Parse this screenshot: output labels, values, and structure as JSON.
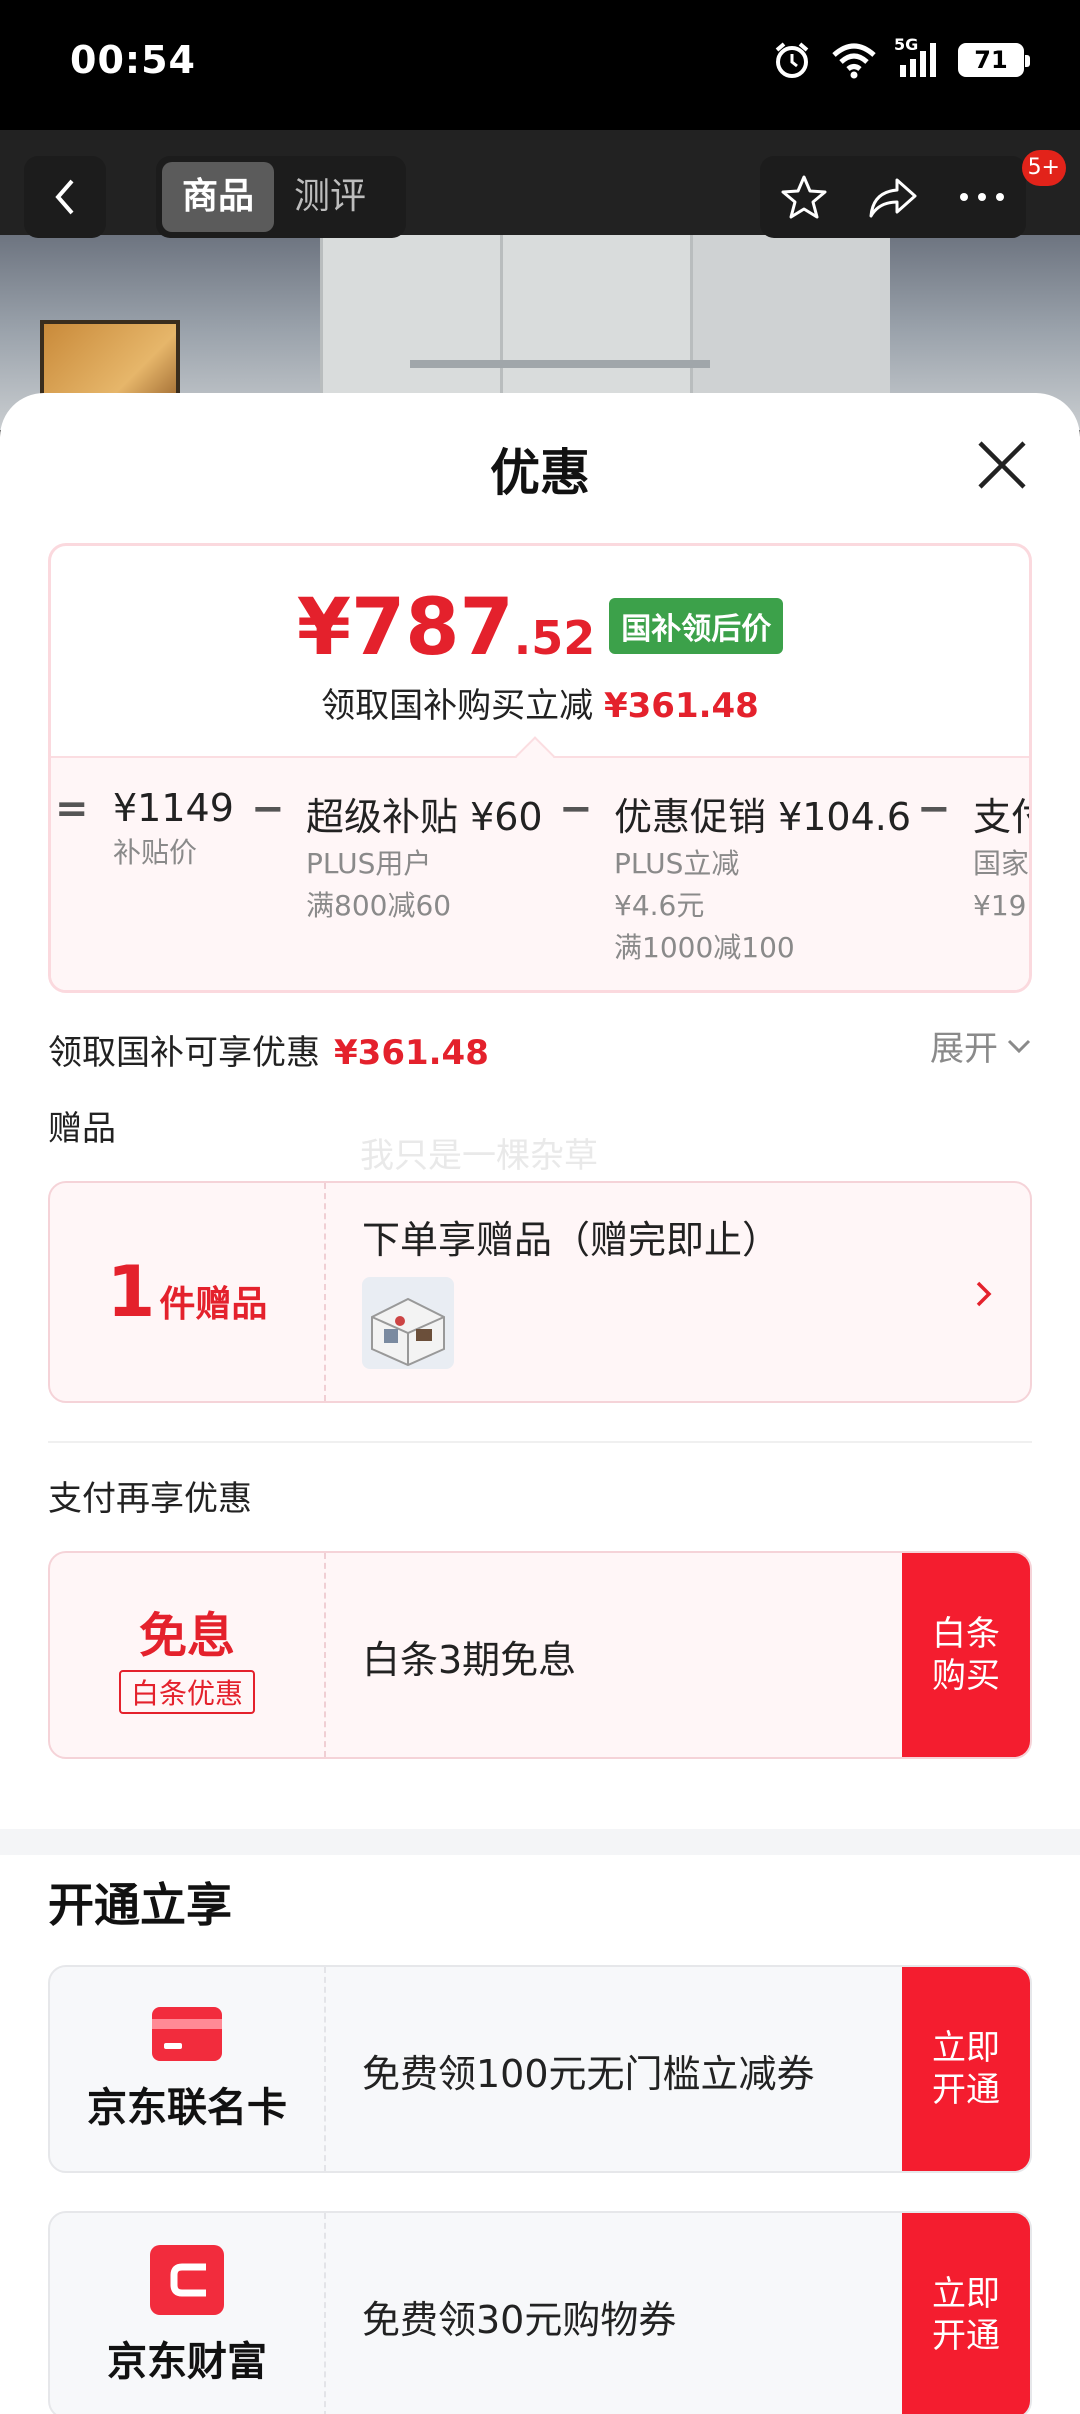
{
  "status_bar": {
    "time": "00:54",
    "network": "5G",
    "battery": "71"
  },
  "nav": {
    "tabs": [
      "商品",
      "测评"
    ],
    "active_tab": "商品",
    "badge": "5+"
  },
  "sheet": {
    "title": "优惠",
    "price": {
      "main": "¥787",
      "decimal": ".52",
      "tag": "国补领后价",
      "subtitle": "领取国补购买立减",
      "subtitle_amount": "¥361.48"
    },
    "calc": [
      {
        "op": "="
      },
      {
        "head": "¥1149",
        "lines": [
          "补贴价"
        ]
      },
      {
        "op": "−"
      },
      {
        "head": "超级补贴 ¥60",
        "lines": [
          "PLUS用户",
          "满800减60"
        ]
      },
      {
        "op": "−"
      },
      {
        "head": "优惠促销 ¥104.6",
        "lines": [
          "PLUS立减",
          "¥4.6元",
          "满1000减100"
        ]
      },
      {
        "op": "−"
      },
      {
        "head": "支付",
        "lines": [
          "国家",
          "¥19"
        ]
      }
    ],
    "discount_row": {
      "label": "领取国补可享优惠",
      "amount": "¥361.48",
      "expand": "展开"
    },
    "gift_section": {
      "label": "赠品",
      "count": "1",
      "unit": "件赠品",
      "text": "下单享赠品（赠完即止）"
    },
    "watermark": "我只是一棵杂草",
    "pay_section": {
      "label": "支付再享优惠",
      "left_title": "免息",
      "left_tag": "白条优惠",
      "text": "白条3期免息",
      "action": "白条\n购买"
    },
    "open_section": {
      "title": "开通立享",
      "items": [
        {
          "name": "京东联名卡",
          "text": "免费领100元无门槛立减券",
          "action": "立即\n开通",
          "icon": "card-icon"
        },
        {
          "name": "京东财富",
          "text": "免费领30元购物券",
          "action": "立即\n开通",
          "icon": "wallet-icon"
        }
      ]
    }
  },
  "colors": {
    "accent_red": "#e4212c",
    "button_red": "#f41d2f",
    "green_tag": "#3ca14a"
  }
}
